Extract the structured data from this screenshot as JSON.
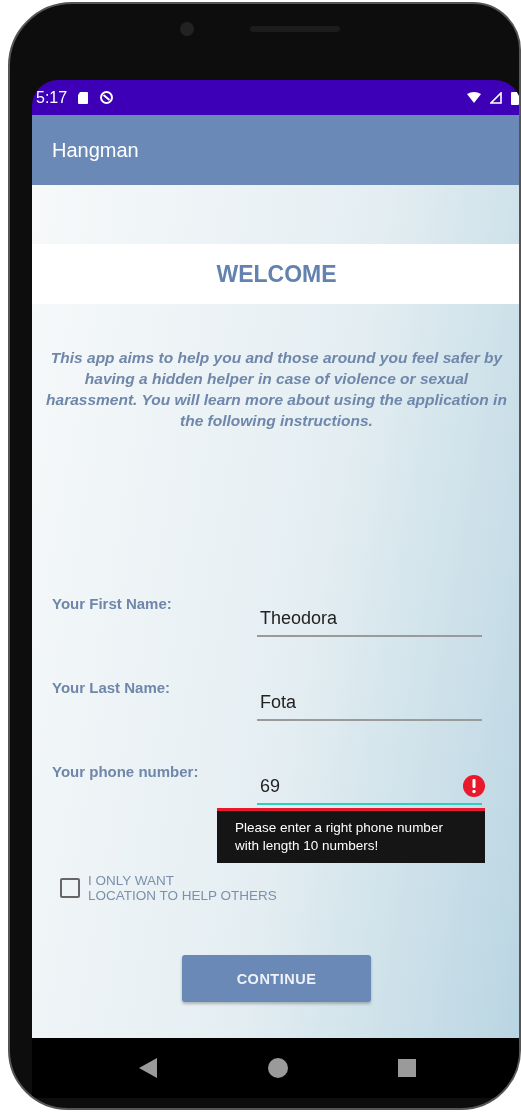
{
  "status_bar": {
    "time": "5:17"
  },
  "app_bar": {
    "title": "Hangman"
  },
  "welcome": {
    "heading": "WELCOME",
    "text": "This app aims to help you and those around you feel safer by having a hidden helper in case of violence or sexual harassment. You will learn more about using the application in the following instructions."
  },
  "fields": [
    {
      "label": "Your First Name:",
      "value": "Theodora",
      "focused": false
    },
    {
      "label": "Your Last Name:",
      "value": "Fota",
      "focused": false
    },
    {
      "label": "Your phone number:",
      "value": "69",
      "focused": true,
      "error": "Please enter a right phone number with length 10 numbers!"
    }
  ],
  "checkbox": {
    "label_lines": [
      "I ONLY WANT",
      "LOCATION TO HELP OTHERS"
    ],
    "checked": false
  },
  "button": {
    "label": "CONTINUE"
  }
}
